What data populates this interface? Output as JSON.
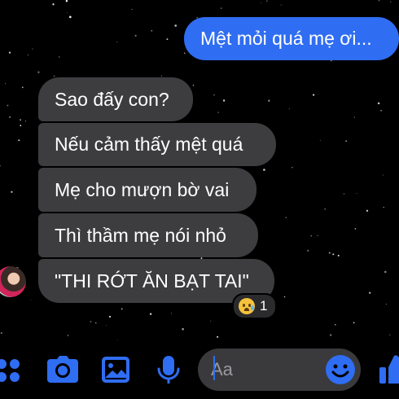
{
  "messages": [
    {
      "direction": "sent",
      "text": "Mệt mỏi quá mẹ ơi..."
    },
    {
      "direction": "received",
      "text": "Sao đấy con?"
    },
    {
      "direction": "received",
      "text": "Nếu cảm thấy mệt quá"
    },
    {
      "direction": "received",
      "text": "Mẹ cho mượn bờ vai"
    },
    {
      "direction": "received",
      "text": "Thì thầm mẹ nói nhỏ"
    },
    {
      "direction": "received",
      "text": "\"THI RỚT ĂN BẠT TAI\""
    }
  ],
  "reaction": {
    "emoji": "sad-tear-face",
    "count": "1"
  },
  "composer": {
    "placeholder": "Aa"
  },
  "toolbar": {
    "icons": [
      "apps-icon",
      "camera-icon",
      "gallery-icon",
      "microphone-icon",
      "emoji-icon",
      "like-icon"
    ]
  },
  "colors": {
    "background": "#000000",
    "sent_bubble": "#2f6df2",
    "received_bubble": "#3d3d40",
    "accent": "#2f6df2"
  }
}
